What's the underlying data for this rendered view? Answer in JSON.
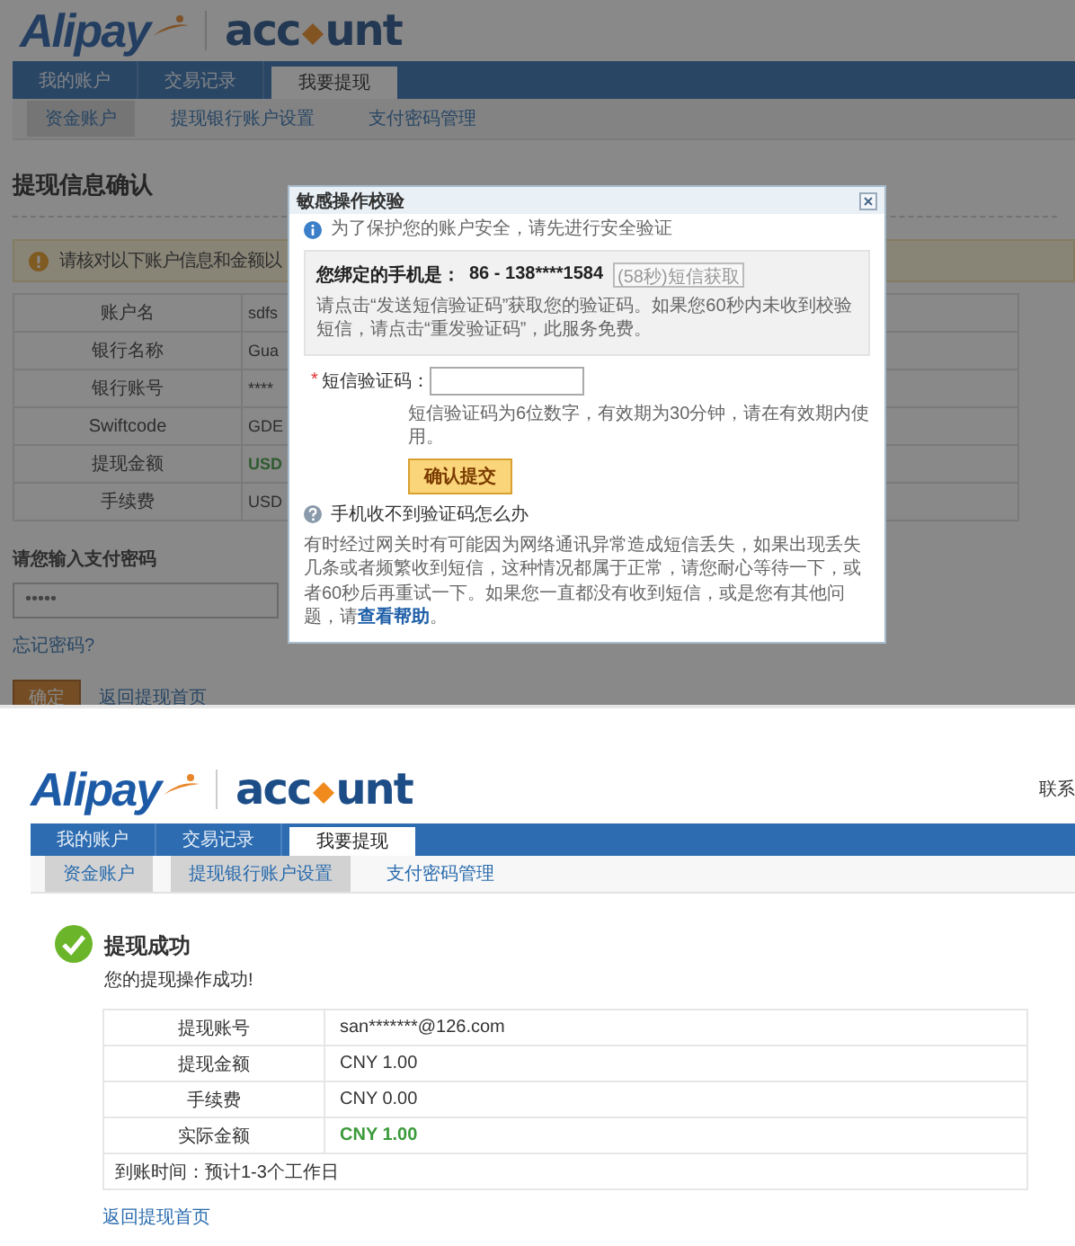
{
  "confirm_page": {
    "logo": {
      "brand": "Alipay",
      "product_start": "acc",
      "product_end": "unt"
    },
    "nav_tabs": [
      {
        "label": "我的账户",
        "selected": false
      },
      {
        "label": "交易记录",
        "selected": false
      },
      {
        "label": "我要提现",
        "selected": true
      }
    ],
    "sub_tabs": [
      {
        "label": "资金账户",
        "selected": true
      },
      {
        "label": "提现银行账户设置",
        "selected": false
      },
      {
        "label": "支付密码管理",
        "selected": false
      }
    ],
    "heading": "提现信息确认",
    "notice": "请核对以下账户信息和金额以",
    "details": [
      {
        "label": "账户名",
        "value": "sdfs",
        "highlighted": false
      },
      {
        "label": "银行名称",
        "value": "Gua",
        "highlighted": false
      },
      {
        "label": "银行账号",
        "value": "****",
        "highlighted": false
      },
      {
        "label": "Swiftcode",
        "value": "GDE",
        "highlighted": false
      },
      {
        "label": "提现金额",
        "value": "USD",
        "highlighted": true
      },
      {
        "label": "手续费",
        "value": "USD",
        "highlighted": false
      }
    ],
    "password_label": "请您输入支付密码",
    "password_value": "•••••",
    "forgot_link": "忘记密码?",
    "confirm_button": "确定",
    "back_link": "返回提现首页",
    "dialog": {
      "title": "敏感操作校验",
      "security_note": "为了保护您的账户安全，请先进行安全验证",
      "phone_label": "您绑定的手机是：",
      "phone_number": "86 - 138****1584",
      "resend_button": "(58秒)短信获取",
      "phone_hint": "请点击“发送短信验证码”获取您的验证码。如果您60秒内未收到校验短信，请点击“重发验证码”，此服务免费。",
      "code_required": "*",
      "code_label": "短信验证码：",
      "code_hint": "短信验证码为6位数字，有效期为30分钟，请在有效期内使用。",
      "submit_button": "确认提交",
      "help_title": "手机收不到验证码怎么办",
      "help_text": "有时经过网关时有可能因为网络通讯异常造成短信丢失，如果出现丢失几条或者频繁收到短信，这种情况都属于正常，请您耐心等待一下，或者60秒后再重试一下。如果您一直都没有收到短信，或是您有其他问题，请",
      "help_link": "查看帮助",
      "help_end": "。"
    }
  },
  "success_page": {
    "logo": {
      "brand": "Alipay",
      "product_start": "acc",
      "product_end": "unt"
    },
    "contact": "联系",
    "nav_tabs": [
      {
        "label": "我的账户",
        "selected": false
      },
      {
        "label": "交易记录",
        "selected": false
      },
      {
        "label": "我要提现",
        "selected": true
      }
    ],
    "sub_tabs": [
      {
        "label": "资金账户",
        "selected": true
      },
      {
        "label": "提现银行账户设置",
        "selected": true
      },
      {
        "label": "支付密码管理",
        "selected": false
      }
    ],
    "title": "提现成功",
    "message": "您的提现操作成功!",
    "details": [
      {
        "label": "提现账号",
        "value": "san*******@126.com",
        "highlighted": false
      },
      {
        "label": "提现金额",
        "value": "CNY 1.00",
        "highlighted": false
      },
      {
        "label": "手续费",
        "value": "CNY 0.00",
        "highlighted": false
      },
      {
        "label": "实际金额",
        "value": "CNY 1.00",
        "highlighted": true
      }
    ],
    "arrival": "到账时间：预计1-3个工作日",
    "back_link": "返回提现首页"
  }
}
